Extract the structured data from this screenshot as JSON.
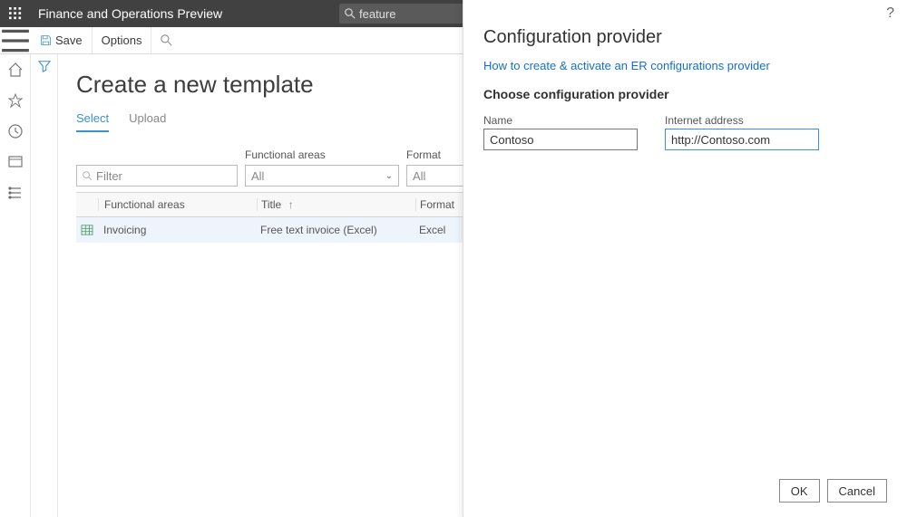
{
  "top": {
    "app_title": "Finance and Operations Preview",
    "search_text": "feature"
  },
  "cmd": {
    "save": "Save",
    "options": "Options"
  },
  "page": {
    "title": "Create a new template",
    "tabs": {
      "select": "Select",
      "upload": "Upload"
    }
  },
  "filters": {
    "filter_placeholder": "Filter",
    "areas_label": "Functional areas",
    "areas_value": "All",
    "format_label": "Format",
    "format_value": "All"
  },
  "grid": {
    "headers": {
      "areas": "Functional areas",
      "title": "Title",
      "sort_arrow": "↑",
      "format": "Format"
    },
    "rows": [
      {
        "areas": "Invoicing",
        "title": "Free text invoice (Excel)",
        "format": "Excel"
      }
    ]
  },
  "panel": {
    "title": "Configuration provider",
    "link": "How to create & activate an ER configurations provider",
    "subtitle": "Choose configuration provider",
    "name_label": "Name",
    "name_value": "Contoso",
    "address_label": "Internet address",
    "address_value": "http://Contoso.com",
    "ok": "OK",
    "cancel": "Cancel"
  }
}
